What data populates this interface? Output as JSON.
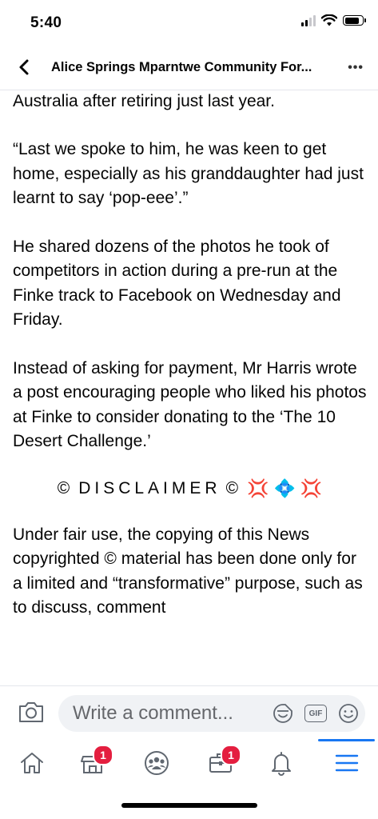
{
  "status_bar": {
    "time": "5:40",
    "battery_level": 0.85
  },
  "nav": {
    "title": "Alice Springs Mparntwe Community For...",
    "back_icon": "chevron-left-icon",
    "more_icon": "ellipsis-icon",
    "more_glyph": "•••"
  },
  "content": {
    "paragraphs": [
      "Australia after retiring just last year.",
      "“Last we spoke to him, he was keen to get home, especially as his granddaughter had just learnt to say ‘pop-eee’.”",
      "He shared dozens of the photos he took of competitors in action during a pre-run at the Finke track to Facebook on Wednesday and Friday.",
      "Instead of asking for payment, Mr Harris wrote a post encouraging people who liked his photos at Finke to consider donating to the ‘The 10 Desert Challenge.’"
    ],
    "disclaimer": {
      "copyright_symbol": "©",
      "text": "DISCLAIMER",
      "anger_emoji": "💢",
      "diamond_emoji": "💠"
    },
    "fair_use": {
      "text_before": "Under fair use, the copying of this News copyrighted",
      "symbol": "©",
      "text_after": "material has been done only for a limited and “transformative” purpose, such as to discuss, comment"
    }
  },
  "comment_bar": {
    "placeholder": "Write a comment...",
    "gif_label": "GIF",
    "icons": [
      "camera-icon",
      "sticker-icon",
      "gif-icon",
      "emoji-icon"
    ]
  },
  "tab_bar": {
    "tabs": [
      {
        "name": "home",
        "icon": "home-icon",
        "badge": ""
      },
      {
        "name": "marketplace",
        "icon": "marketplace-icon",
        "badge": "1"
      },
      {
        "name": "groups",
        "icon": "groups-icon",
        "badge": ""
      },
      {
        "name": "jobs",
        "icon": "briefcase-icon",
        "badge": "1"
      },
      {
        "name": "notifications",
        "icon": "bell-icon",
        "badge": ""
      },
      {
        "name": "menu",
        "icon": "menu-icon",
        "badge": "",
        "active": true
      }
    ]
  },
  "colors": {
    "accent": "#1877f2",
    "badge": "#e41e3f",
    "input_bg": "#f0f2f5",
    "text": "#050505",
    "muted": "#65676b"
  }
}
